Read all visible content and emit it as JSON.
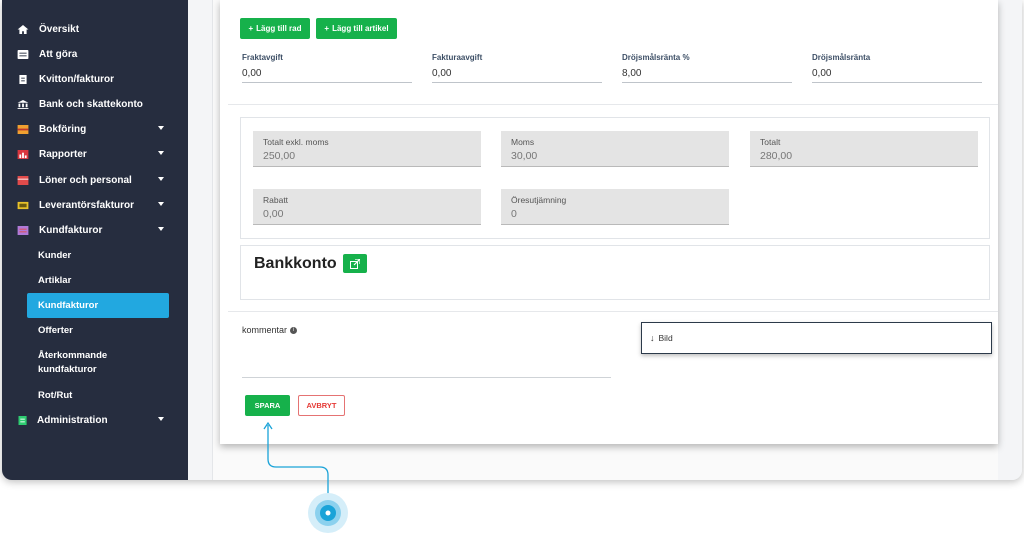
{
  "sidebar": {
    "items": [
      {
        "label": "Översikt",
        "icon": "home-icon"
      },
      {
        "label": "Att göra",
        "icon": "list-icon"
      },
      {
        "label": "Kvitton/fakturor",
        "icon": "receipt-icon"
      },
      {
        "label": "Bank och skattekonto",
        "icon": "bank-icon"
      },
      {
        "label": "Bokföring",
        "icon": "book-icon"
      },
      {
        "label": "Rapporter",
        "icon": "chart-icon"
      },
      {
        "label": "Löner och personal",
        "icon": "wallet-icon"
      },
      {
        "label": "Leverantörsfakturor",
        "icon": "supplier-invoice-icon"
      },
      {
        "label": "Kundfakturor",
        "icon": "customer-invoice-icon"
      },
      {
        "label": "Administration",
        "icon": "admin-icon"
      }
    ],
    "sub_items": [
      {
        "label": "Kunder"
      },
      {
        "label": "Artiklar"
      },
      {
        "label": "Kundfakturor"
      },
      {
        "label": "Offerter"
      },
      {
        "label": "Återkommande kundfakturor"
      },
      {
        "label": "Rot/Rut"
      }
    ],
    "active_sub": "Kundfakturor",
    "bg_color": "#262d3f",
    "active_color": "#22a8e0"
  },
  "toolbar": {
    "add_row_label": "Lägg till rad",
    "add_article_label": "Lägg till artikel"
  },
  "fees": [
    {
      "label": "Fraktavgift",
      "value": "0,00"
    },
    {
      "label": "Fakturaavgift",
      "value": "0,00"
    },
    {
      "label": "Dröjsmålsränta %",
      "value": "8,00"
    },
    {
      "label": "Dröjsmålsränta",
      "value": "0,00"
    }
  ],
  "totals": [
    {
      "label": "Totalt exkl. moms",
      "value": "250,00"
    },
    {
      "label": "Moms",
      "value": "30,00"
    },
    {
      "label": "Totalt",
      "value": "280,00"
    },
    {
      "label": "Rabatt",
      "value": "0,00"
    },
    {
      "label": "Öresutjämning",
      "value": "0"
    }
  ],
  "bank": {
    "title": "Bankkonto"
  },
  "comment": {
    "label": "kommentar"
  },
  "image": {
    "label": "Bild"
  },
  "actions": {
    "save_label": "SPARA",
    "cancel_label": "AVBRYT"
  },
  "colors": {
    "green": "#16b14b",
    "danger": "#e53935",
    "pointer": "#1aa3d8"
  }
}
